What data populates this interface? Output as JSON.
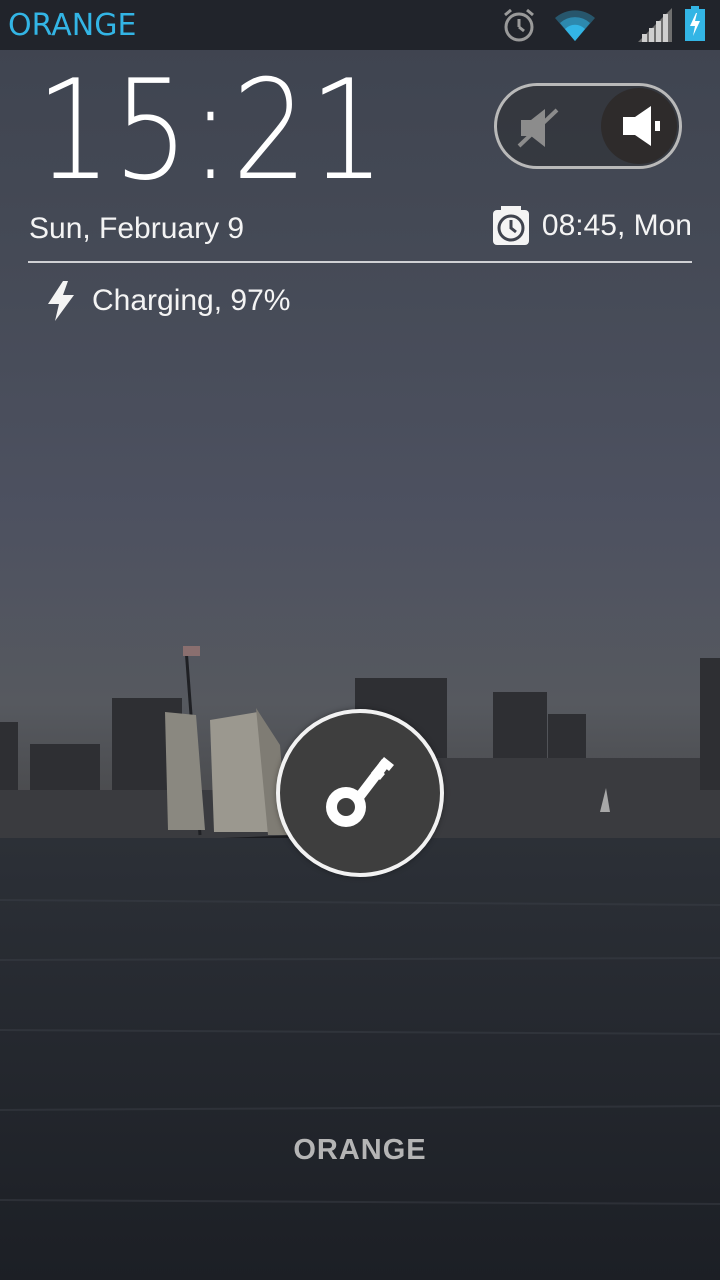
{
  "status_bar": {
    "carrier": "ORANGE",
    "icons": [
      "alarm-icon",
      "wifi-icon",
      "signal-icon",
      "battery-charging-icon"
    ],
    "accent_color": "#33b5e5"
  },
  "lockscreen": {
    "time": "15:21",
    "date": "Sun, February 9",
    "next_alarm": "08:45, Mon",
    "charging_status": "Charging, 97%",
    "bottom_carrier": "ORANGE"
  },
  "sound_toggle": {
    "state": "sound-on",
    "icons": [
      "muted-speaker-icon",
      "speaker-icon"
    ]
  },
  "unlock": {
    "icon": "key-icon"
  }
}
